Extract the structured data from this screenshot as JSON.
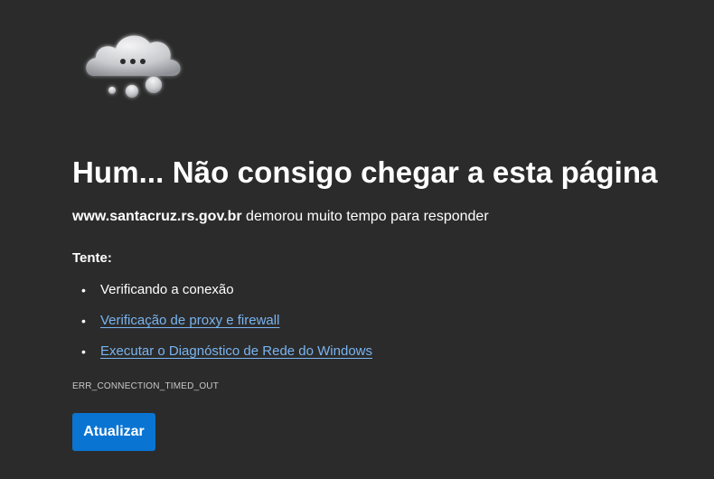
{
  "error_page": {
    "icon": "cloud-thinking-icon",
    "title": "Hum... Não consigo chegar a esta página",
    "host": "www.santacruz.rs.gov.br",
    "message": " demorou muito tempo para responder",
    "try_label": "Tente:",
    "suggestions": [
      {
        "text": "Verificando a conexão",
        "is_link": false
      },
      {
        "text": "Verificação de proxy e firewall",
        "is_link": true
      },
      {
        "text": "Executar o Diagnóstico de Rede do Windows",
        "is_link": true
      }
    ],
    "error_code": "ERR_CONNECTION_TIMED_OUT",
    "refresh_label": "Atualizar"
  },
  "colors": {
    "background": "#2b2b2b",
    "link": "#79b4f0",
    "button": "#0a74d3"
  }
}
